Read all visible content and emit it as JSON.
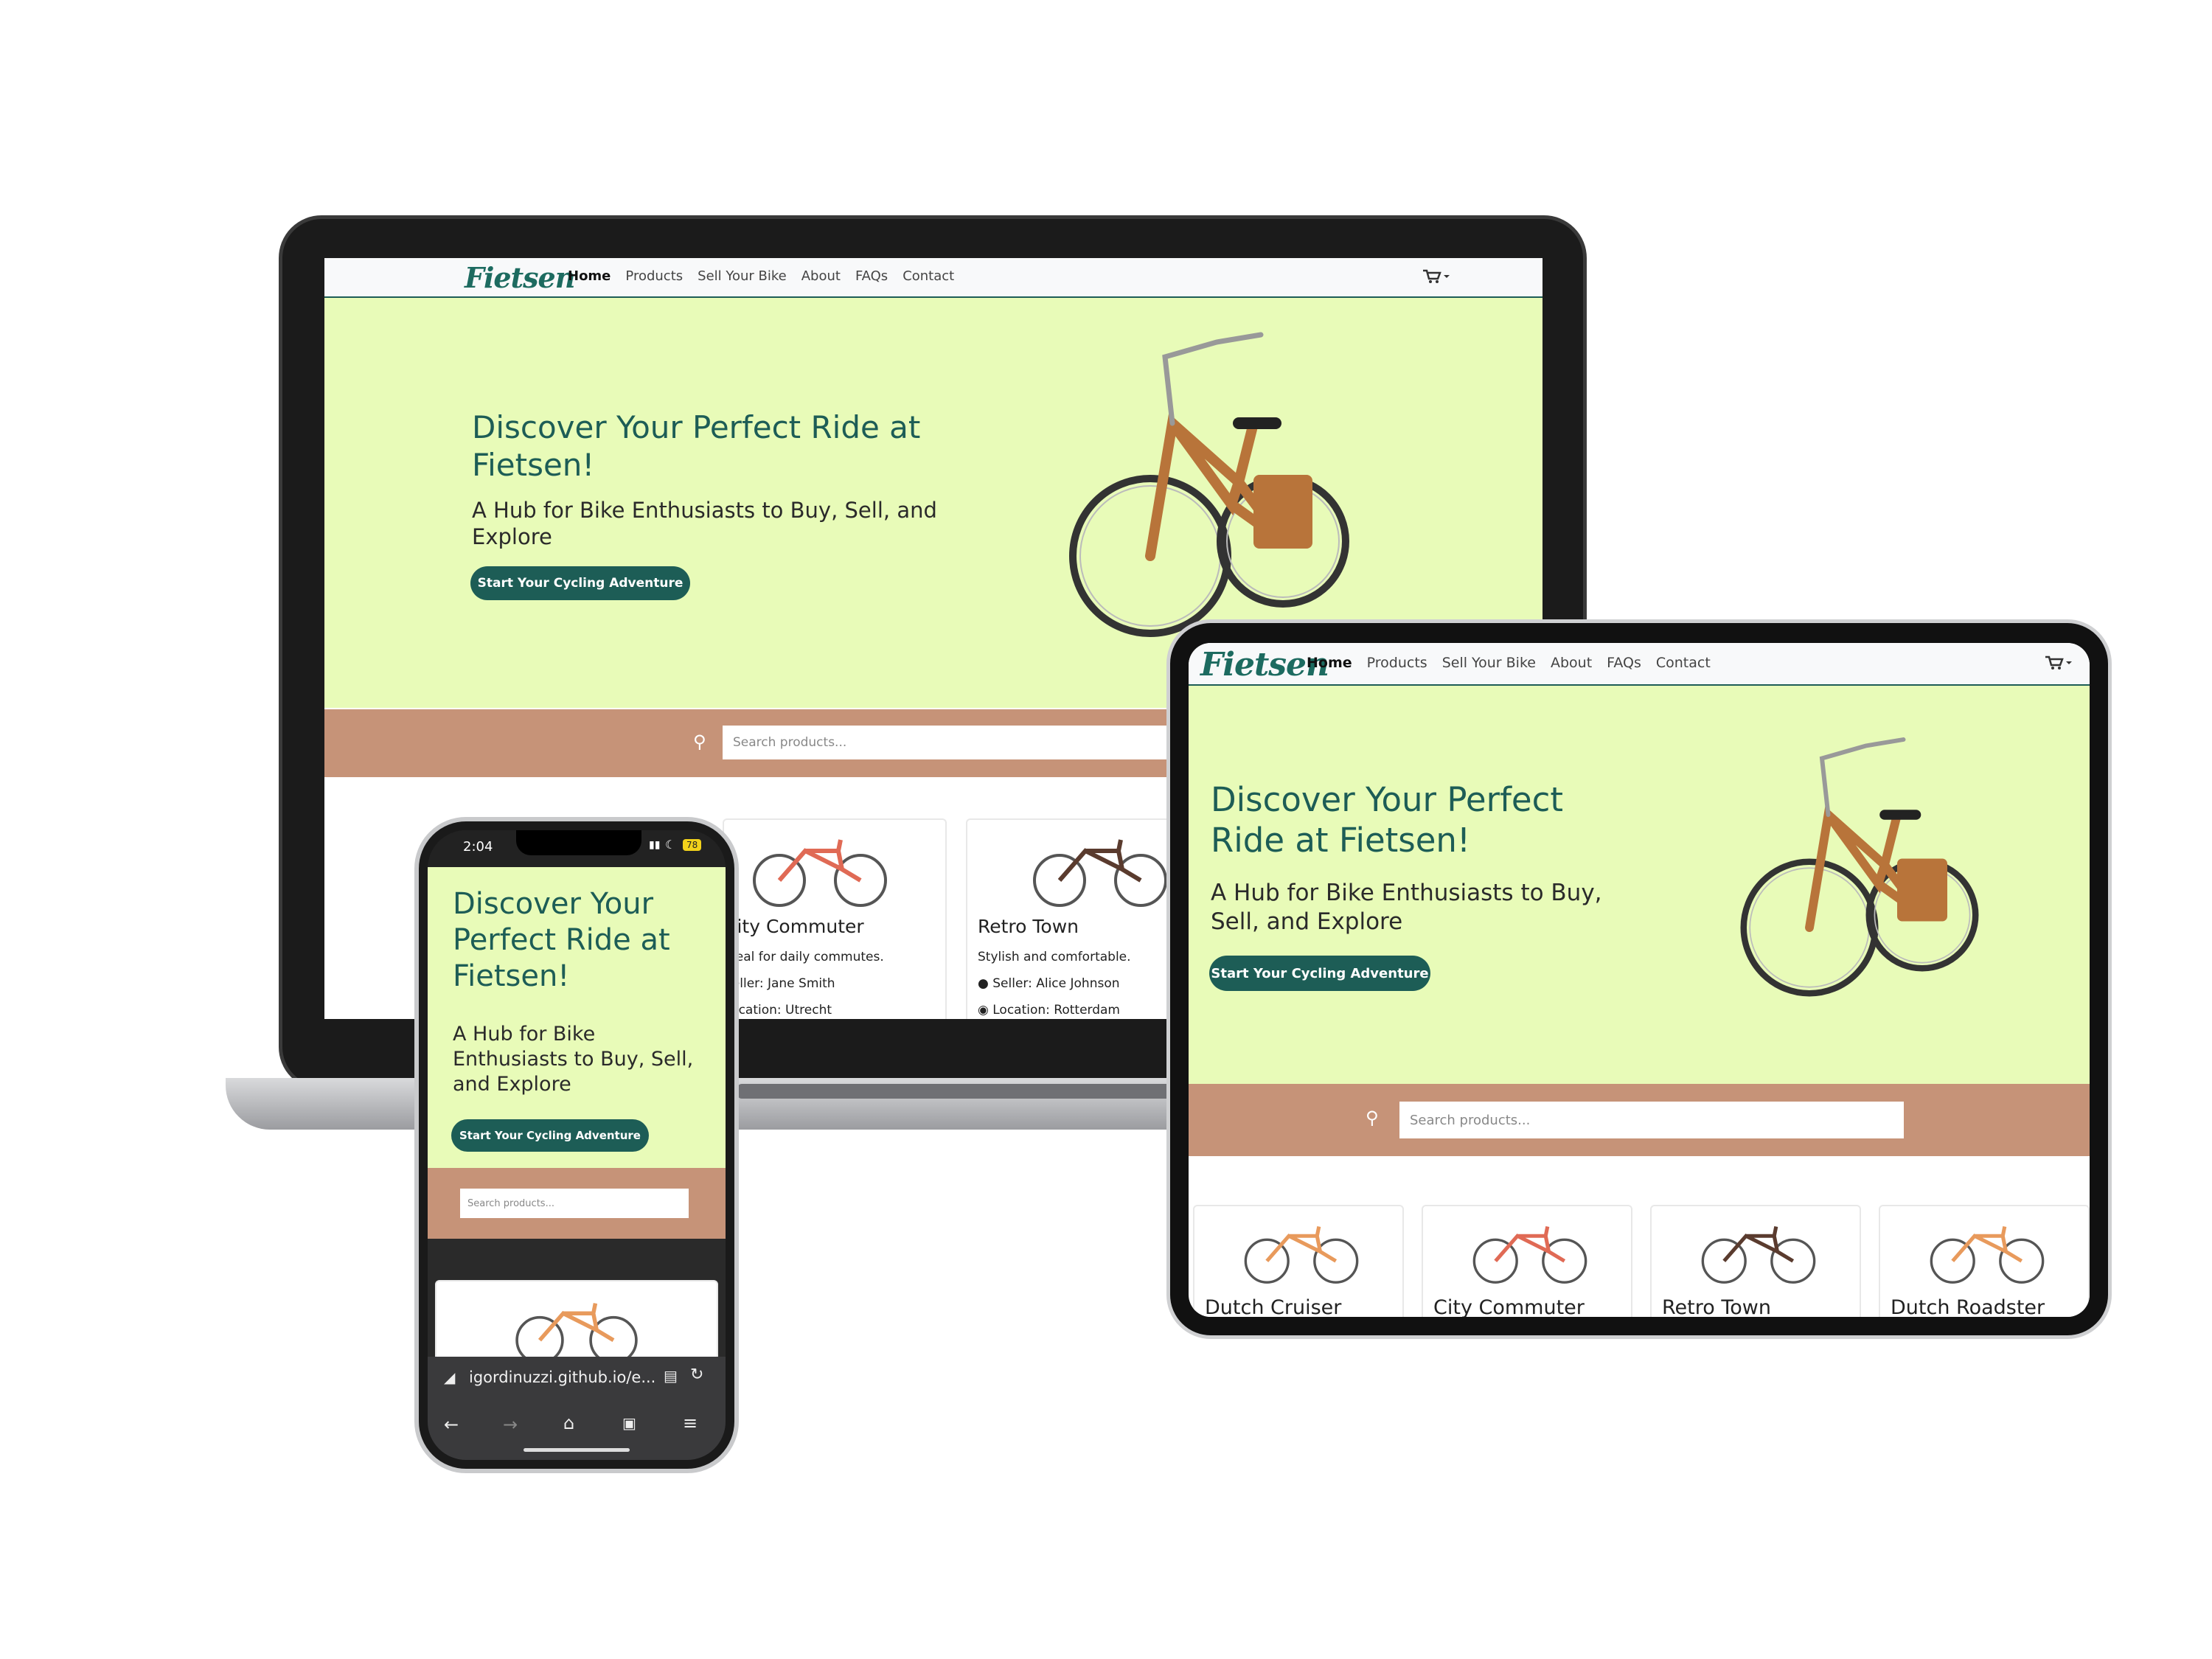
{
  "site": {
    "logo": "Fietsen",
    "nav": [
      "Home",
      "Products",
      "Sell Your Bike",
      "About",
      "FAQs",
      "Contact"
    ],
    "hero_title": "Discover Your Perfect Ride at Fietsen!",
    "hero_subtitle": "A Hub for Bike Enthusiasts to Buy, Sell, and Explore",
    "cta_label": "Start Your Cycling Adventure",
    "search_placeholder": "Search products...",
    "cart_icon": "cart-icon",
    "search_icon": "search-icon"
  },
  "laptop_products": [
    {
      "name": "City Commuter",
      "desc": "Ideal for daily commutes.",
      "seller": "Seller: Jane Smith",
      "location": "Location: Utrecht",
      "frame_color": "#e06a55"
    },
    {
      "name": "Retro Town",
      "desc": "Stylish and comfortable.",
      "seller": "Seller: Alice Johnson",
      "location": "Location: Rotterdam",
      "frame_color": "#5a3b2e"
    }
  ],
  "tablet_products": [
    {
      "name": "Dutch Cruiser",
      "frame_color": "#e89a5c"
    },
    {
      "name": "City Commuter",
      "frame_color": "#e06a55"
    },
    {
      "name": "Retro Town",
      "frame_color": "#5a3b2e"
    },
    {
      "name": "Dutch Roadster",
      "frame_color": "#e89a5c"
    }
  ],
  "phone": {
    "time": "2:04",
    "battery": "78",
    "url": "igordinuzzi.github.io/e..."
  },
  "colors": {
    "primary": "#1d5d56",
    "hero_bg": "#e8fbb8",
    "search_band": "#c69378",
    "bike_frame": "#b8743a"
  }
}
